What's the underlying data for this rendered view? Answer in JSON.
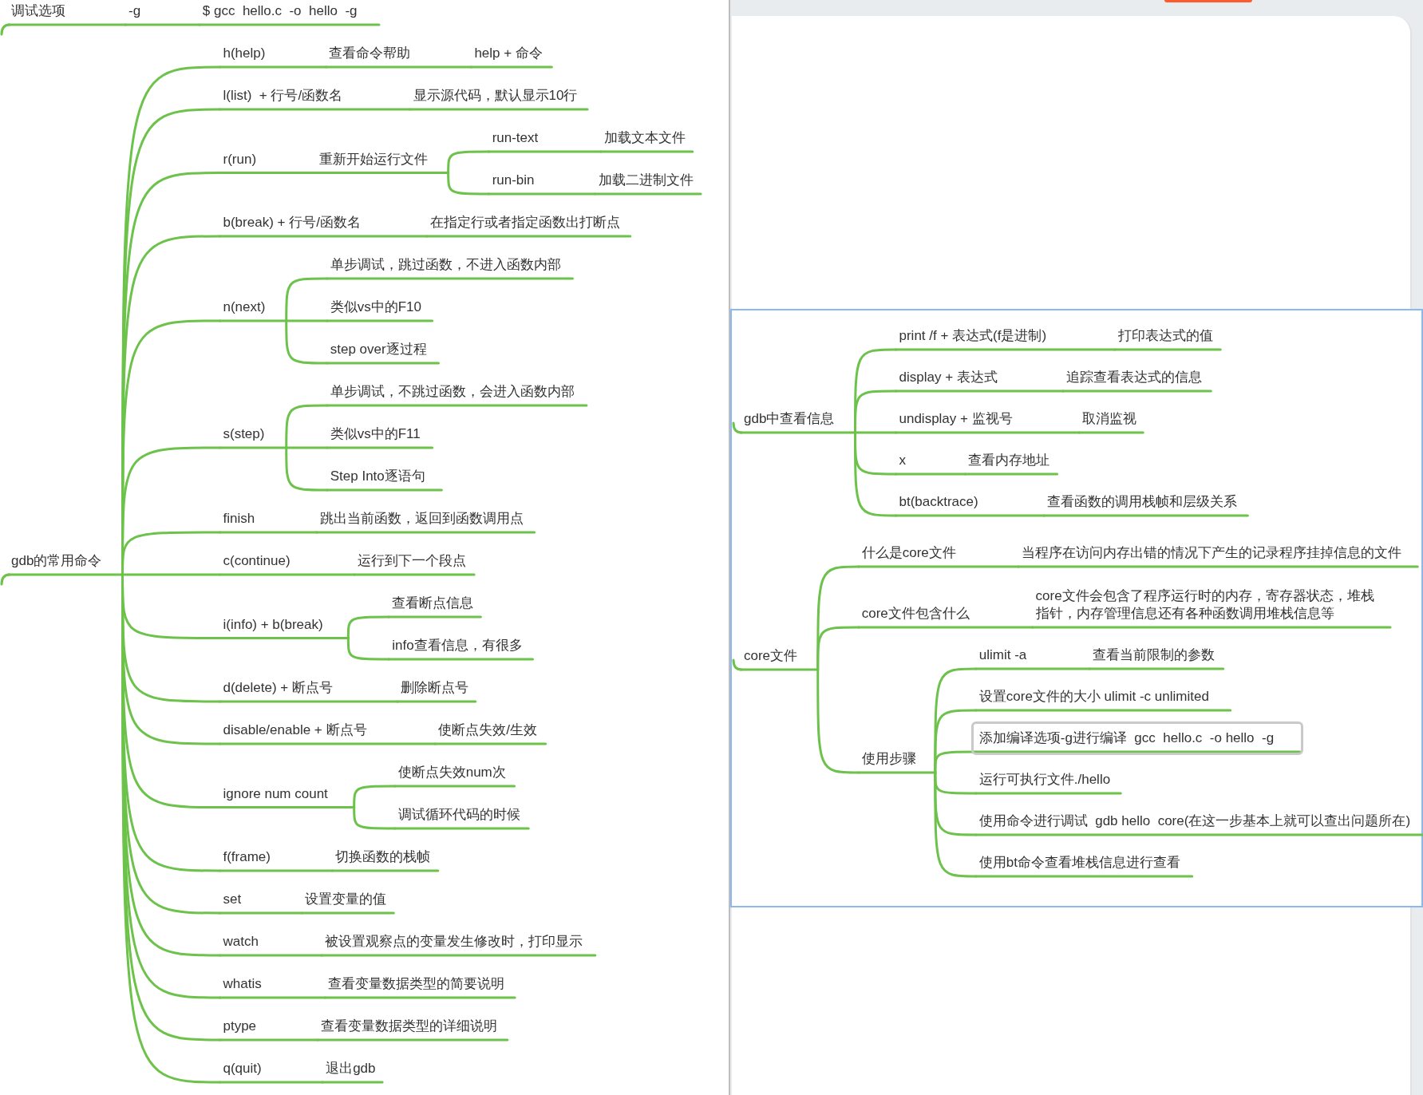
{
  "left_map": {
    "roots": [
      {
        "text": "调试选项",
        "children": [
          {
            "text": "-g",
            "children": [
              {
                "text": "$ gcc  hello.c  -o  hello  -g"
              }
            ]
          }
        ]
      },
      {
        "text": "gdb的常用命令",
        "children": [
          {
            "text": "h(help)",
            "children": [
              {
                "text": "查看命令帮助",
                "children": [
                  {
                    "text": "help + 命令"
                  }
                ]
              }
            ]
          },
          {
            "text": "l(list)  + 行号/函数名",
            "children": [
              {
                "text": "显示源代码，默认显示10行"
              }
            ]
          },
          {
            "text": "r(run)",
            "children": [
              {
                "text": "重新开始运行文件",
                "children": [
                  {
                    "text": "run-text",
                    "children": [
                      {
                        "text": "加载文本文件"
                      }
                    ]
                  },
                  {
                    "text": "run-bin",
                    "children": [
                      {
                        "text": "加载二进制文件"
                      }
                    ]
                  }
                ]
              }
            ]
          },
          {
            "text": "b(break) + 行号/函数名",
            "children": [
              {
                "text": "在指定行或者指定函数出打断点"
              }
            ]
          },
          {
            "text": "n(next)",
            "children": [
              {
                "text": "单步调试，跳过函数，不进入函数内部"
              },
              {
                "text": "类似vs中的F10"
              },
              {
                "text": "step over逐过程"
              }
            ]
          },
          {
            "text": "s(step)",
            "children": [
              {
                "text": "单步调试，不跳过函数，会进入函数内部"
              },
              {
                "text": "类似vs中的F11"
              },
              {
                "text": "Step Into逐语句"
              }
            ]
          },
          {
            "text": "finish",
            "children": [
              {
                "text": "跳出当前函数，返回到函数调用点"
              }
            ]
          },
          {
            "text": "c(continue)",
            "children": [
              {
                "text": "运行到下一个段点"
              }
            ]
          },
          {
            "text": "i(info) + b(break)",
            "children": [
              {
                "text": "查看断点信息"
              },
              {
                "text": "info查看信息，有很多"
              }
            ]
          },
          {
            "text": "d(delete) + 断点号",
            "children": [
              {
                "text": "删除断点号"
              }
            ]
          },
          {
            "text": "disable/enable + 断点号",
            "children": [
              {
                "text": "使断点失效/生效"
              }
            ]
          },
          {
            "text": "ignore num count",
            "children": [
              {
                "text": "使断点失效num次"
              },
              {
                "text": "调试循环代码的时候"
              }
            ]
          },
          {
            "text": "f(frame)",
            "children": [
              {
                "text": "切换函数的栈帧"
              }
            ]
          },
          {
            "text": "set",
            "children": [
              {
                "text": "设置变量的值"
              }
            ]
          },
          {
            "text": "watch",
            "children": [
              {
                "text": "被设置观察点的变量发生修改时，打印显示"
              }
            ]
          },
          {
            "text": "whatis",
            "children": [
              {
                "text": "查看变量数据类型的简要说明"
              }
            ]
          },
          {
            "text": "ptype",
            "children": [
              {
                "text": "查看变量数据类型的详细说明"
              }
            ]
          },
          {
            "text": "q(quit)",
            "children": [
              {
                "text": "退出gdb"
              }
            ]
          }
        ]
      }
    ]
  },
  "right_panel": {
    "roots": [
      {
        "text": "gdb中查看信息",
        "children": [
          {
            "text": "print /f + 表达式(f是进制)",
            "children": [
              {
                "text": "打印表达式的值"
              }
            ]
          },
          {
            "text": "display + 表达式",
            "children": [
              {
                "text": "追踪查看表达式的信息"
              }
            ]
          },
          {
            "text": "undisplay + 监视号",
            "children": [
              {
                "text": "取消监视"
              }
            ]
          },
          {
            "text": "x",
            "children": [
              {
                "text": "查看内存地址"
              }
            ]
          },
          {
            "text": "bt(backtrace)",
            "children": [
              {
                "text": "查看函数的调用栈帧和层级关系"
              }
            ]
          }
        ]
      },
      {
        "text": "core文件",
        "children": [
          {
            "text": "什么是core文件",
            "children": [
              {
                "text": "当程序在访问内存出错的情况下产生的记录程序挂掉信息的文件"
              }
            ]
          },
          {
            "text": "core文件包含什么",
            "children": [
              {
                "lines": [
                  "core文件会包含了程序运行时的内存，寄存器状态，堆栈",
                  "指针，内存管理信息还有各种函数调用堆栈信息等"
                ]
              }
            ]
          },
          {
            "text": "使用步骤",
            "children": [
              {
                "text": "ulimit -a",
                "selected": false,
                "children": [
                  {
                    "text": "查看当前限制的参数"
                  }
                ]
              },
              {
                "text": "设置core文件的大小 ulimit -c unlimited",
                "selected": false
              },
              {
                "text": "添加编译选项-g进行编译  gcc  hello.c  -o hello  -g",
                "selected": true
              },
              {
                "text": "运行可执行文件./hello",
                "selected": false
              },
              {
                "text": "使用命令进行调试  gdb hello  core(在这一步基本上就可以查出问题所在)",
                "selected": false
              },
              {
                "text": "使用bt命令查看堆栈信息进行查看",
                "selected": false
              }
            ]
          }
        ]
      }
    ]
  }
}
